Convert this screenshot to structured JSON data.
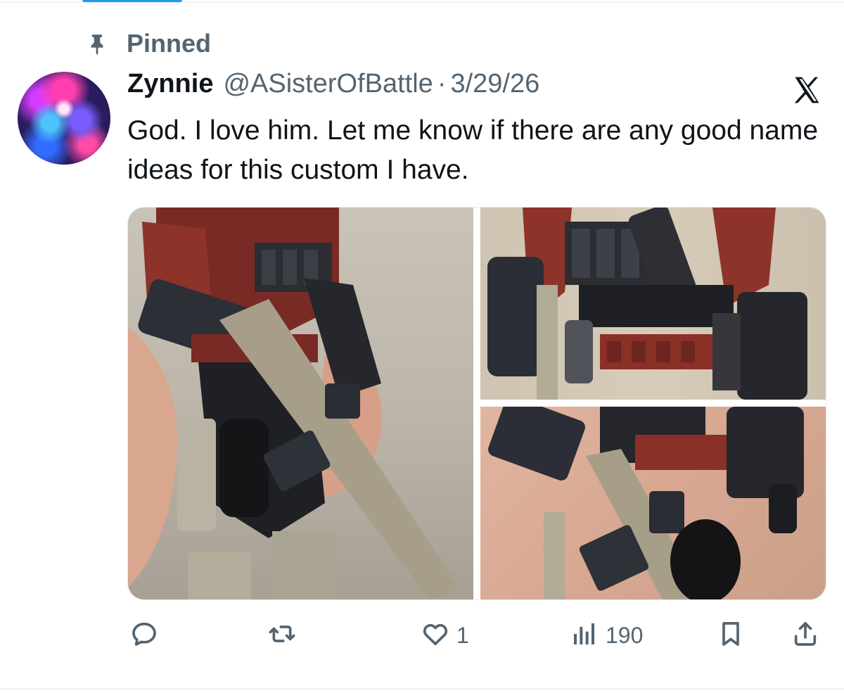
{
  "pinned": {
    "label": "Pinned",
    "icon": "pin-icon"
  },
  "author": {
    "display_name": "Zynnie",
    "handle": "@ASisterOfBattle",
    "separator": "·",
    "date": "3/29/26",
    "avatar_icon": "avatar"
  },
  "platform_icon": "x-logo-icon",
  "tweet": {
    "text": "God. I love him. Let me know if there are any good name ideas for this custom I have."
  },
  "media": {
    "count": 3,
    "images": [
      "custom-figure-rifle",
      "custom-figure-belt-closeup",
      "custom-figure-hand-closeup"
    ]
  },
  "actions": {
    "reply": {
      "icon": "reply-icon",
      "count": ""
    },
    "retweet": {
      "icon": "retweet-icon",
      "count": ""
    },
    "like": {
      "icon": "heart-icon",
      "count": "1"
    },
    "views": {
      "icon": "views-icon",
      "count": "190"
    },
    "bookmark": {
      "icon": "bookmark-icon"
    },
    "share": {
      "icon": "share-icon"
    }
  },
  "colors": {
    "accent": "#1d9bf0",
    "text_primary": "#0f1419",
    "text_secondary": "#536471",
    "divider": "#eff3f4"
  }
}
